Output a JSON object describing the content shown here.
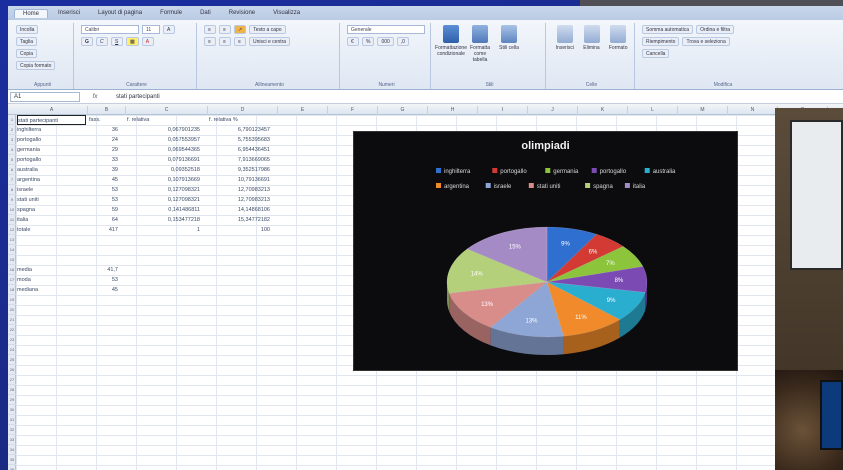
{
  "ribbon": {
    "tabs": [
      "Home",
      "Inserisci",
      "Layout di pagina",
      "Formule",
      "Dati",
      "Revisione",
      "Visualizza"
    ],
    "groups": [
      "Appunti",
      "Carattere",
      "Allineamento",
      "Numeri",
      "Stili",
      "Celle",
      "Modifica"
    ],
    "paste_label": "Incolla",
    "cut_label": "Taglia",
    "copy_label": "Copia",
    "format_painter_label": "Copia formato",
    "font_name": "Calibri",
    "font_size": "11",
    "wrap_text_label": "Testo a capo",
    "merge_label": "Unisci e centra",
    "number_format": "Generale",
    "cond_format_label": "Formattazione condizionale",
    "format_table_label": "Formatta come tabella",
    "cell_styles_label": "Stili cella",
    "insert_label": "Inserisci",
    "delete_label": "Elimina",
    "format_label": "Formato",
    "autosum_label": "Somma automatica",
    "fill_label": "Riempimento",
    "clear_label": "Cancella",
    "sort_filter_label": "Ordina e filtra",
    "find_select_label": "Trova e seleziona"
  },
  "formula_bar": {
    "name_box": "A1",
    "fx": "fx",
    "content": "stati partecipanti"
  },
  "columns": [
    "A",
    "B",
    "C",
    "D",
    "E",
    "F",
    "G",
    "H",
    "I",
    "J",
    "K",
    "L",
    "M",
    "N",
    "O",
    "P",
    "Q"
  ],
  "table": {
    "headers": [
      "stati partecipanti",
      "fass.",
      "f. relativa",
      "f. relativa %"
    ],
    "rows": [
      [
        "inghilterra",
        "36",
        "0,067901235",
        "6,790123457"
      ],
      [
        "portogallo",
        "24",
        "0,057553957",
        "5,755395683"
      ],
      [
        "germania",
        "29",
        "0,069544365",
        "6,954436451"
      ],
      [
        "portogallo",
        "33",
        "0,079136691",
        "7,913669065"
      ],
      [
        "australia",
        "39",
        "0,09352518",
        "9,352517986"
      ],
      [
        "argentina",
        "45",
        "0,107913669",
        "10,79136691"
      ],
      [
        "israele",
        "53",
        "0,127098321",
        "12,70983213"
      ],
      [
        "stati uniti",
        "53",
        "0,127098321",
        "12,70983213"
      ],
      [
        "spagna",
        "59",
        "0,141486811",
        "14,14868106"
      ],
      [
        "italia",
        "64",
        "0,153477218",
        "15,34772182"
      ],
      [
        "totale",
        "417",
        "1",
        "100"
      ]
    ],
    "stats": [
      [
        "media",
        "41,7"
      ],
      [
        "moda",
        "53"
      ],
      [
        "mediana",
        "45"
      ]
    ]
  },
  "chart_data": {
    "type": "pie",
    "title": "olimpiadi",
    "legend_position": "top",
    "categories": [
      "inghilterra",
      "portogallo",
      "germania",
      "portogallo",
      "australia",
      "argentina",
      "israele",
      "stati uniti",
      "spagna",
      "italia"
    ],
    "values": [
      36,
      24,
      29,
      33,
      39,
      45,
      53,
      53,
      59,
      64
    ],
    "data_labels": [
      "9%",
      "6%",
      "7%",
      "8%",
      "9%",
      "11%",
      "13%",
      "13%",
      "14%",
      "15%"
    ],
    "colors": [
      "#2f6fd0",
      "#d23a33",
      "#8cc43c",
      "#7b4ab3",
      "#2aaed0",
      "#f08a2a",
      "#8ea6d6",
      "#d98d8b",
      "#b4d07a",
      "#a58bc6"
    ]
  }
}
